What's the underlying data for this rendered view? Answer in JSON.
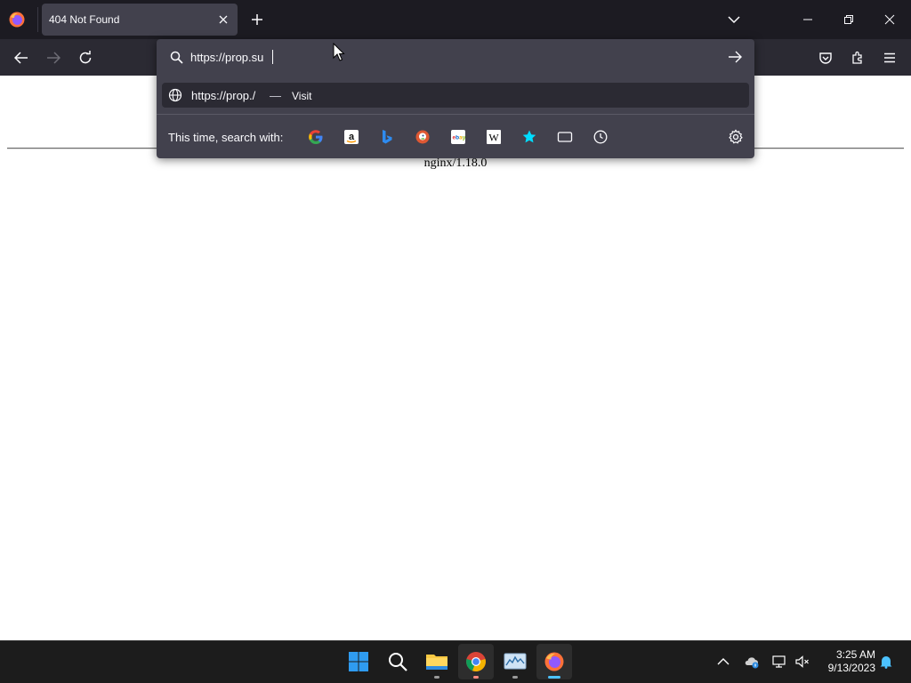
{
  "browser": {
    "tab": {
      "title": "404 Not Found"
    },
    "urlbar": {
      "value": "https://prop.su",
      "suggestion": {
        "url": "https://prop./",
        "separator": "—",
        "action": "Visit"
      },
      "search_with_label": "This time, search with:",
      "engines": [
        {
          "name": "Google",
          "icon": "google-icon"
        },
        {
          "name": "Amazon",
          "icon": "amazon-icon"
        },
        {
          "name": "Bing",
          "icon": "bing-icon"
        },
        {
          "name": "DuckDuckGo",
          "icon": "duckduckgo-icon"
        },
        {
          "name": "eBay",
          "icon": "ebay-icon"
        },
        {
          "name": "Wikipedia",
          "icon": "wikipedia-icon"
        },
        {
          "name": "Bookmarks",
          "icon": "star-icon"
        },
        {
          "name": "Tabs",
          "icon": "tabs-icon"
        },
        {
          "name": "History",
          "icon": "history-icon"
        }
      ]
    }
  },
  "page": {
    "footer": "nginx/1.18.0"
  },
  "taskbar": {
    "apps": [
      "start",
      "search",
      "file-explorer",
      "chrome",
      "system-monitor",
      "firefox"
    ],
    "clock": {
      "time": "3:25 AM",
      "date": "9/13/2023"
    }
  },
  "colors": {
    "tab_strip": "#1c1b22",
    "toolbar": "#2b2a33",
    "panel": "#42414d",
    "text_light": "#fbfbfe",
    "taskbar": "#1c1c1c",
    "focus_accent": "#4cc2ff"
  }
}
